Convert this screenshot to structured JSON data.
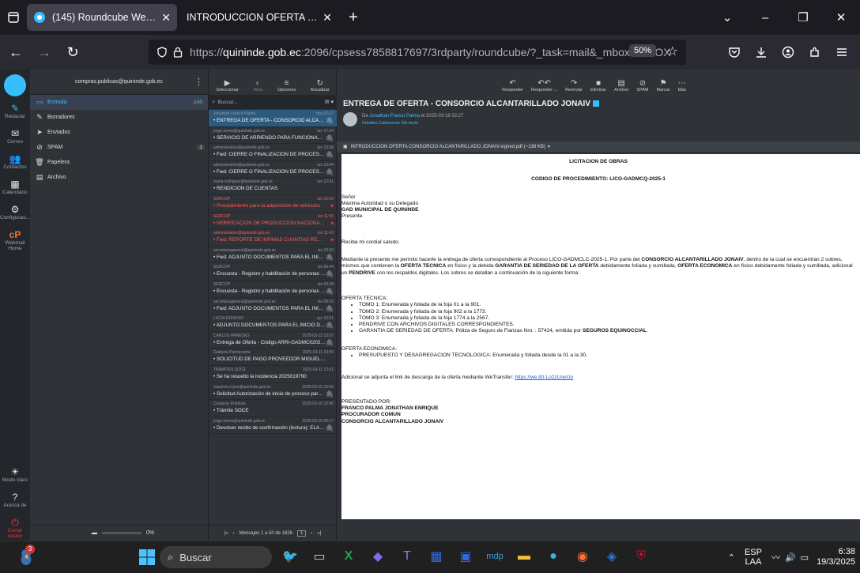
{
  "browser": {
    "tabs": [
      {
        "title": "(145) Roundcube Webmail :: Ent",
        "active": true
      },
      {
        "title": "INTRODUCCION OFERTA CONSORC",
        "active": false
      }
    ],
    "new_tab": "+",
    "url_prefix": "https://",
    "url_host": "quininde.gob.ec",
    "url_rest": ":2096/cpsess7858817697/3rdparty/roundcube/?_task=mail&_mbox=INBOX",
    "zoom": "50%"
  },
  "rail": {
    "items": [
      {
        "icon": "✎",
        "label": "Redactar",
        "active": true
      },
      {
        "icon": "✉",
        "label": "Correo",
        "active": false
      },
      {
        "icon": "👥",
        "label": "Contactos",
        "active": false
      },
      {
        "icon": "▦",
        "label": "Calendario",
        "active": false
      },
      {
        "icon": "⚙",
        "label": "Configuraci...",
        "active": false
      },
      {
        "icon": "cP",
        "label": "Webmail Home",
        "active": false
      }
    ],
    "bottom": [
      {
        "icon": "☀",
        "label": "Modo claro"
      },
      {
        "icon": "?",
        "label": "Acerca de"
      },
      {
        "icon": "⏻",
        "label": "Cerrar sesión"
      }
    ]
  },
  "folders": {
    "account": "compras.publicas@quininde.gob.ec",
    "items": [
      {
        "icon": "▭",
        "label": "Entrada",
        "count": "145",
        "selected": true
      },
      {
        "icon": "✎",
        "label": "Borradores",
        "count": ""
      },
      {
        "icon": "➤",
        "label": "Enviados",
        "count": ""
      },
      {
        "icon": "⊘",
        "label": "SPAM",
        "count": "1"
      },
      {
        "icon": "🗑",
        "label": "Papelera",
        "count": ""
      },
      {
        "icon": "▤",
        "label": "Archivo",
        "count": ""
      }
    ],
    "quota": "0%"
  },
  "list": {
    "toolbar": [
      {
        "icon": "▶",
        "label": "Seleccionar"
      },
      {
        "icon": "◐",
        "label": "Hilos"
      },
      {
        "icon": "≡",
        "label": "Opciones"
      },
      {
        "icon": "↻",
        "label": "Actualizar"
      }
    ],
    "search_placeholder": "Buscar...",
    "messages": [
      {
        "from": "Jonathan Franco Palma",
        "date": "Hoy 02:27",
        "subject": "ENTREGA DE OFERTA - CONSORCIO ALCANTARIL...",
        "selected": true,
        "flag": false,
        "clip": true
      },
      {
        "from": "jorge.torres@quininde.gob.ec",
        "date": "lun 17:34",
        "subject": "SERVICIO DE ARRIENDO PARA FUNCIONAMIENT...",
        "selected": false,
        "flag": false,
        "clip": true
      },
      {
        "from": "administrativo@quininde.gob.ec",
        "date": "lun 13:38",
        "subject": "Fwd: CIERRE O FINALIZACIÓN DE PROCESO SIE-...",
        "selected": false,
        "flag": false,
        "clip": true
      },
      {
        "from": "administrativo@quininde.gob.ec",
        "date": "lun 13:44",
        "subject": "Fwd: CIERRE O FINALIZACIÓN DE PROCESO SIE-...",
        "selected": false,
        "flag": false,
        "clip": true
      },
      {
        "from": "maria.rodriguez@quininde.gob.ec",
        "date": "lun 12:41",
        "subject": "RENDICION DE CUENTAS",
        "selected": false,
        "flag": false,
        "clip": false
      },
      {
        "from": "SERCOP",
        "date": "lun 12:06",
        "subject": "Procedimiento para la adquisición de vehículos",
        "selected": false,
        "flag": true,
        "clip": false
      },
      {
        "from": "SERCOP",
        "date": "lun 11:55",
        "subject": "VERIFICACIÓN DE PRODUCCIÓN NACIONAL - CO...",
        "selected": false,
        "flag": true,
        "clip": false
      },
      {
        "from": "administrativo@quininde.gob.ec",
        "date": "lun 11:43",
        "subject": "Fwd: REPORTE DE INFIMAS CUANTIAS RENDICIO...",
        "selected": false,
        "flag": true,
        "clip": false
      },
      {
        "from": "secretariageneral@quininde.gob.ec",
        "date": "vie 10:33",
        "subject": "Fwd: ADJUNTO DOCUMENTOS PARA EL INICIO D...",
        "selected": false,
        "flag": false,
        "clip": true
      },
      {
        "from": "SERCOP",
        "date": "vie 09:44",
        "subject": "Encuesta - Registro y habilitación de personas nat...",
        "selected": false,
        "flag": false,
        "clip": true
      },
      {
        "from": "SERCOP",
        "date": "vie 09:28",
        "subject": "Encuesta - Registro y habilitación de personas nat...",
        "selected": false,
        "flag": false,
        "clip": true
      },
      {
        "from": "secretariageneral@quininde.gob.ec",
        "date": "vie 08:59",
        "subject": "Fwd: ADJUNTO DOCUMENTOS PARA EL INICIO D...",
        "selected": false,
        "flag": false,
        "clip": true
      },
      {
        "from": "LUCIA DONOSO",
        "date": "jue 16:01",
        "subject": "ADJUNTO DOCUMENTOS PARA EL INICIO DE PR...",
        "selected": false,
        "flag": false,
        "clip": true
      },
      {
        "from": "CARLOS PAREDES",
        "date": "2025-03-12 15:07",
        "subject": "Entrega de Oferta - Código ARRI-GADMC02025-3",
        "selected": false,
        "flag": false,
        "clip": true
      },
      {
        "from": "Gabriela Pachacama",
        "date": "2025-03-11 10:55",
        "subject": "SOLICITUD DE PAGO PROVEEDOR MIGUEL GUTIE...",
        "selected": false,
        "flag": false,
        "clip": false
      },
      {
        "from": "TRAMITES SOCE",
        "date": "2025-03-11 12:51",
        "subject": "Se ha resuelto la incidencia 2025019790",
        "selected": false,
        "flag": false,
        "clip": false
      },
      {
        "from": "mauricio.reyes@quininde.gob.ec",
        "date": "2025-03-10 15:06",
        "subject": "Solicitud Autorización de inicio de proceso para ...",
        "selected": false,
        "flag": false,
        "clip": true
      },
      {
        "from": "Compras Publicas",
        "date": "2025-03-10 12:40",
        "subject": "Trámite SOCE",
        "selected": false,
        "flag": false,
        "clip": false
      },
      {
        "from": "jorge.torres@quininde.gob.ec",
        "date": "2025-03-10 09:17",
        "subject": "Devolver recibo de confirmación (lectura): ELABO...",
        "selected": false,
        "flag": false,
        "clip": true
      }
    ],
    "footer": "Mensajes 1 a 50 de 1826",
    "page": "1"
  },
  "viewer": {
    "toolbar": [
      {
        "icon": "↶",
        "label": "Responder"
      },
      {
        "icon": "↶↶",
        "label": "Responder ..."
      },
      {
        "icon": "↷",
        "label": "Reenviar"
      },
      {
        "icon": "■",
        "label": "Eliminar"
      },
      {
        "icon": "▤",
        "label": "Archivo"
      },
      {
        "icon": "⊘",
        "label": "SPAM"
      },
      {
        "icon": "⚑",
        "label": "Marcar"
      },
      {
        "icon": "⋯",
        "label": "Más"
      }
    ],
    "subject": "ENTREGA DE OFERTA - CONSORCIO ALCANTARILLADO JONAIV",
    "from_prefix": "De",
    "from_name": "Jonathan Franco Palma",
    "from_date": "el 2025-03-19 02:27",
    "links": "Detalles   Cabeceras   Sin texto",
    "attachment": "INTRODUCCION OFERTA CONSORCIO ALCANTARILLADO JONAIV-signed.pdf (~138 KB)",
    "doc": {
      "title": "LICITACION DE OBRAS",
      "code": "CODIGO DE PROCEDIMIENTO: LICO-GADMCQ-2025-1",
      "l1": "Señor",
      "l2": "Máxima Autoridad o su Delegado",
      "l3": "GAD MUNICIPAL DE QUININDE",
      "l4": "Presente.",
      "greet": "Reciba mi cordial saludo.",
      "p1a": "Mediante la presente me permito hacerle la entrega de oferta correspondiente al Proceso LICO-GADMCLC-2025-1, Por parte del ",
      "p1b": "CONSORCIO ALCANTARILLADO JONAIV",
      "p1c": ", dentro de la cual se encuentran 2 sobres, mismos que contienen la ",
      "p1d": "OFERTA TECNICA",
      "p1e": " en físico y la debida ",
      "p1f": "GARANTIA DE SERIEDAD DE LA OFERTA",
      "p1g": " debidamente foliada y sumillada, ",
      "p1h": "OFERTA ECONOMICA",
      "p1i": " en físico debidamente foliada y sumillada, adicional un ",
      "p1j": "PENDRIVE",
      "p1k": " con los respaldos digitales. Los sobres se detallan a continuación de la siguiente forma:",
      "tech_head": "OFERTA TECNICA:",
      "tech": [
        "TOMO 1: Enumerada y foliada de la foja 01 a la 901.",
        "TOMO 2: Enumerada y foliada de la foja 902 a la 1773.",
        "TOMO 3: Enumerada y foliada de la foja 1774 a la 2567.",
        "PENDRIVE CON ARCHIVOS DIGITALES CORRESPONDIENTES."
      ],
      "g1": "GARANTIA DE SERIEDAD DE OFERTA: Póliza de Seguro de Fianzas Nro. : 57424, emitida por ",
      "g2": "SEGUROS EQUINOCCIAL",
      "econ_head": "OFERTA ECONOMICA:",
      "econ": "PRESUPUESTO Y DESAGREGACION TECNOLOGICA: Enumerada y foliada desde la 01 a la 30.",
      "wt": "Adicional se adjunta el link de descarga de la oferta mediante WeTransfer: ",
      "wt_link": "https://we.tl/t-Lo2zUoeUo",
      "by_head": "PRESENTADO POR:",
      "by1": "FRANCO PALMA JONATHAN ENRIQUE",
      "by2": "PROCURADOR COMUN",
      "by3": "CONSORCIO ALCANTARILLADO JONAIV"
    }
  },
  "taskbar": {
    "weather_badge": "3",
    "search": "Buscar",
    "lang1": "ESP",
    "lang2": "LAA",
    "time": "6:38",
    "date": "19/3/2025"
  }
}
